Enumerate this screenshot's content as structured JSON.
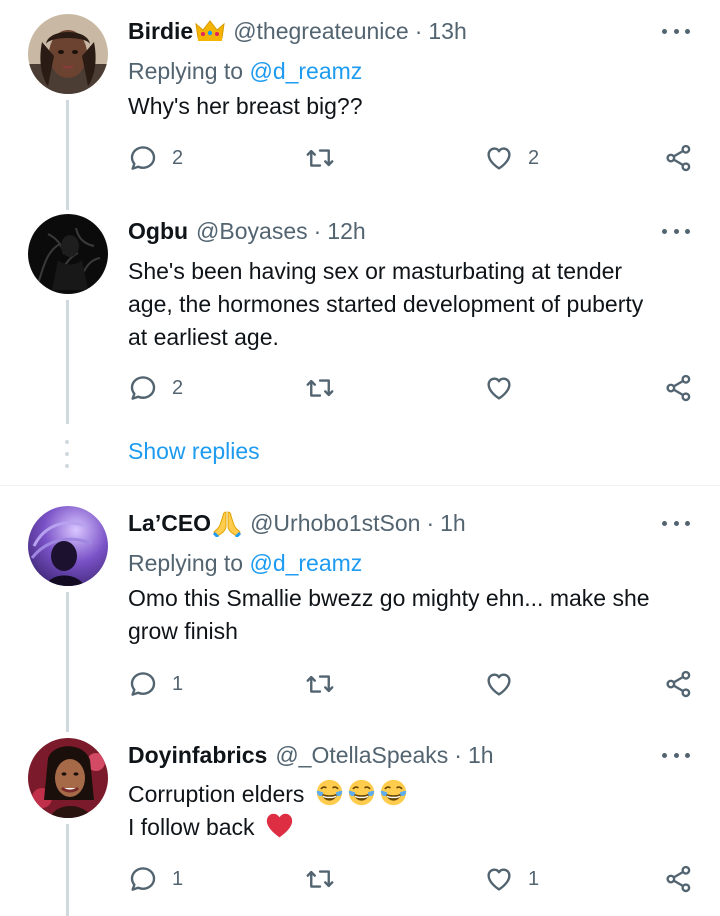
{
  "tweets": [
    {
      "name": "Birdie",
      "name_emoji": "crown",
      "handle": "@thegreateunice",
      "time": "13h",
      "replying_prefix": "Replying to",
      "replying_to": "@d_reamz",
      "lines": [
        "Why's her breast big??"
      ],
      "reply_count": "2",
      "retweet_count": "",
      "like_count": "2"
    },
    {
      "name": "Ogbu",
      "handle": "@Boyases",
      "time": "12h",
      "lines": [
        "She's been having sex or masturbating at tender",
        "age, the hormones started development of puberty",
        "at earliest age."
      ],
      "reply_count": "2",
      "retweet_count": "",
      "like_count": ""
    },
    {
      "name": "La’CEO",
      "name_emoji": "folded-hands",
      "handle": "@Urhobo1stSon",
      "time": "1h",
      "replying_prefix": "Replying to",
      "replying_to": "@d_reamz",
      "lines": [
        "Omo this Smallie bwezz go mighty ehn...  make she",
        "grow finish"
      ],
      "reply_count": "1",
      "retweet_count": "",
      "like_count": ""
    },
    {
      "name": "Doyinfabrics",
      "handle": "@_OtellaSpeaks",
      "time": "1h",
      "lines": [
        "Corruption elders",
        "I follow back"
      ],
      "line_emojis": [
        "tears-of-joy",
        "tears-of-joy",
        "tears-of-joy",
        "red-heart"
      ],
      "reply_count": "1",
      "retweet_count": "",
      "like_count": "1"
    }
  ],
  "show_replies": "Show replies",
  "separator_dot": "·",
  "colors": {
    "link": "#1d9bf0",
    "secondary_text": "#536471",
    "thread_line": "#cfd9de",
    "heart": "#e0245e"
  },
  "icons": [
    "reply-icon",
    "retweet-icon",
    "like-icon",
    "share-icon",
    "more-icon"
  ]
}
